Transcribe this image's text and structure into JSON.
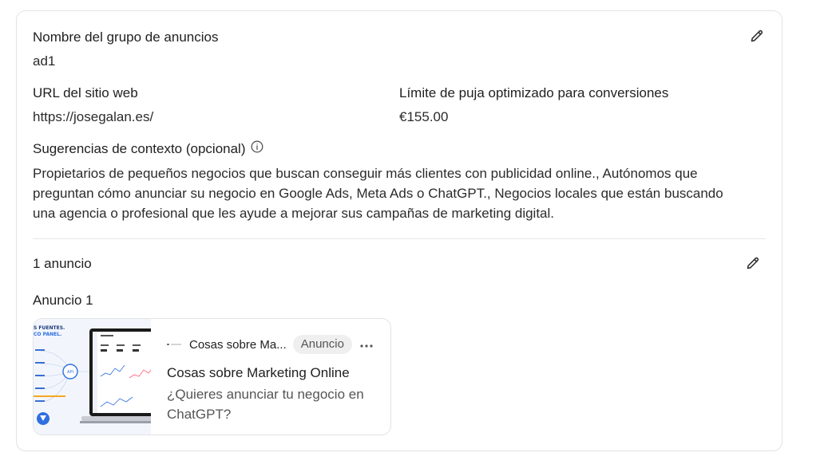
{
  "ad_group": {
    "name_label": "Nombre del grupo de anuncios",
    "name_value": "ad1",
    "url_label": "URL del sitio web",
    "url_value": "https://josegalan.es/",
    "bid_label": "Límite de puja optimizado para conversiones",
    "bid_value": "€155.00",
    "context_label": "Sugerencias de contexto (opcional)",
    "context_value": "Propietarios de pequeños negocios que buscan conseguir más clientes con publicidad online., Autónomos que preguntan cómo anunciar su negocio en Google Ads, Meta Ads o ChatGPT., Negocios locales que están buscando una agencia o profesional que les ayude a mejorar sus campañas de marketing digital."
  },
  "ads": {
    "count_label": "1 anuncio",
    "ad1_label": "Anuncio 1",
    "preview": {
      "brand": "Cosas sobre Ma...",
      "badge": "Anuncio",
      "title": "Cosas sobre Marketing Online",
      "description": "¿Quieres anunciar tu negocio en ChatGPT?",
      "thumb_text_1": "S FUENTES.",
      "thumb_text_2": "CO PANEL.",
      "thumb_api": "API"
    }
  },
  "icons": {
    "edit": "pencil-icon",
    "info": "info-icon",
    "more": "more-horizontal-icon"
  },
  "colors": {
    "border": "#e3e3e3",
    "badge_bg": "#efefef",
    "accent_blue": "#2f6fe0"
  }
}
